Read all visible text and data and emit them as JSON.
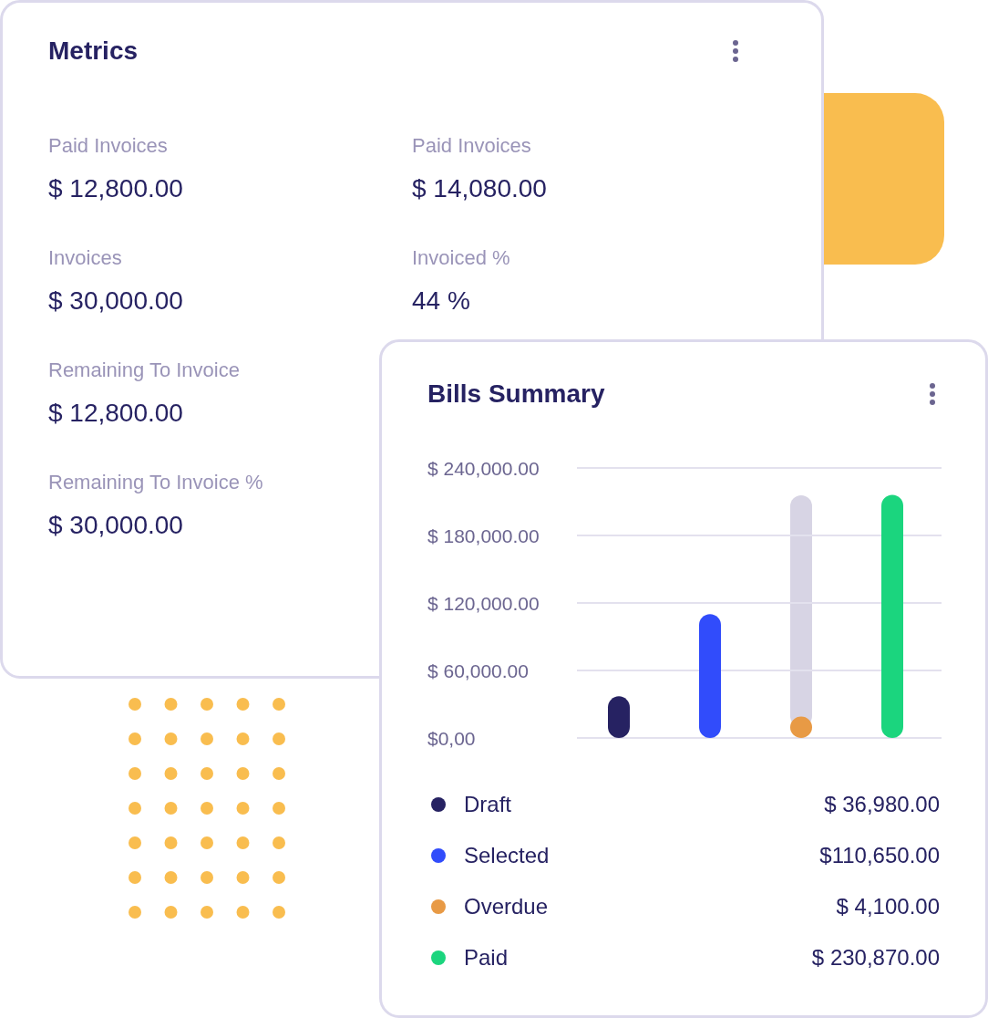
{
  "metrics": {
    "title": "Metrics",
    "columns": [
      [
        {
          "label": "Paid Invoices",
          "value": "$ 12,800.00"
        },
        {
          "label": "Invoices",
          "value": "$ 30,000.00"
        },
        {
          "label": "Remaining To Invoice",
          "value": "$ 12,800.00"
        },
        {
          "label": "Remaining To Invoice %",
          "value": "$ 30,000.00"
        }
      ],
      [
        {
          "label": "Paid Invoices",
          "value": "$ 14,080.00"
        },
        {
          "label": "Invoiced %",
          "value": "44 %"
        }
      ]
    ]
  },
  "bills_summary": {
    "title": "Bills Summary",
    "chart_data": {
      "type": "bar",
      "grid": true,
      "series": [
        {
          "name": "Draft",
          "color": "#262262",
          "values": [
            37000
          ]
        },
        {
          "name": "Selected",
          "color": "#314cfb",
          "values": [
            110000
          ]
        },
        {
          "name": "Overdue",
          "color": "#e89a45",
          "values": [
            19000
          ]
        },
        {
          "name": "Paid",
          "color": "#1bd57e",
          "values": [
            216000
          ]
        }
      ],
      "ylim": [
        0,
        240000
      ],
      "yticks": [
        {
          "value": 0,
          "label": "$0,00"
        },
        {
          "value": 60000,
          "label": "$ 60,000.00"
        },
        {
          "value": 120000,
          "label": "$ 120,000.00"
        },
        {
          "value": 180000,
          "label": "$ 180,000.00"
        },
        {
          "value": 240000,
          "label": "$ 240,000.00"
        }
      ]
    },
    "legend_values": [
      "$ 36,980.00",
      "$110,650.00",
      "$ 4,100.00",
      "$ 230,870.00"
    ]
  }
}
